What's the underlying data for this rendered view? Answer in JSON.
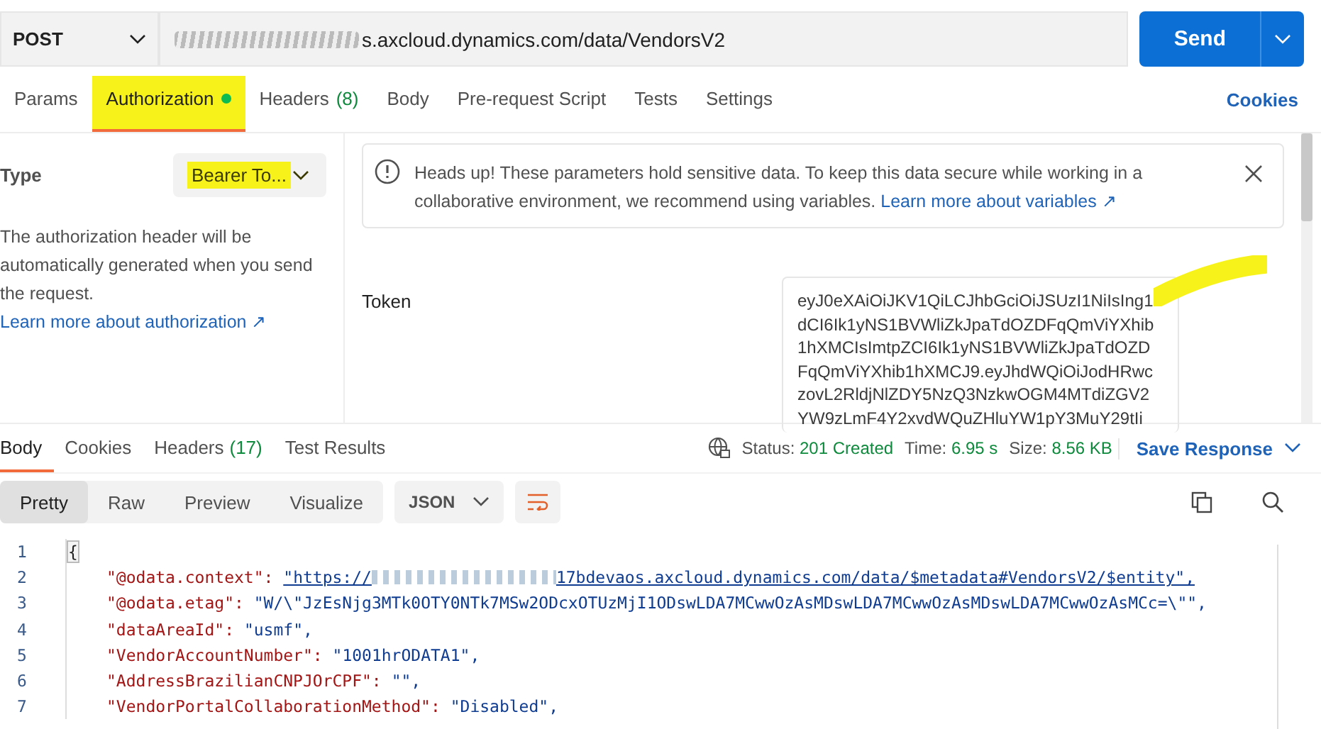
{
  "request": {
    "method": "POST",
    "url_visible": "s.axcloud.dynamics.com/data/VendorsV2",
    "send": "Send"
  },
  "request_tabs": [
    {
      "label": "Params",
      "selected": false,
      "dot": false
    },
    {
      "label": "Authorization",
      "selected": true,
      "dot": true
    },
    {
      "label": "Headers",
      "count": "(8)",
      "selected": false,
      "dot": false
    },
    {
      "label": "Body",
      "selected": false,
      "dot": false
    },
    {
      "label": "Pre-request Script",
      "selected": false,
      "dot": false
    },
    {
      "label": "Tests",
      "selected": false,
      "dot": false
    },
    {
      "label": "Settings",
      "selected": false,
      "dot": false
    }
  ],
  "cookies_link": "Cookies",
  "auth": {
    "type_label": "Type",
    "type_value": "Bearer To...",
    "description": "The authorization header will be automatically generated when you send the request.",
    "learn_more": "Learn more about authorization ↗"
  },
  "notice": {
    "text": "Heads up! These parameters hold sensitive data. To keep this data secure while working in a collaborative environment, we recommend using variables.",
    "link": "Learn more about variables ↗"
  },
  "token": {
    "label": "Token",
    "lines": [
      "eyJ0eXAiOiJKV1QiLCJhbGciOiJSUzI1NiIsIng1",
      "dCI6Ik1yNS1BVWliZkJpaTdOZDFqQmViYXhib",
      "1hXMCIsImtpZCI6Ik1yNS1BVWliZkJpaTdOZD",
      "FqQmViYXhib1hXMCJ9.eyJhdWQiOiJodHRwc",
      "zovL2RldjNlZDY5NzQ3NzkwOGM4MTdiZGV2",
      "YW9zLmF4Y2xvdWQuZHluYW1pY3MuY29tIi"
    ]
  },
  "response_tabs": [
    {
      "label": "Body",
      "selected": true
    },
    {
      "label": "Cookies",
      "selected": false
    },
    {
      "label": "Headers",
      "count": "(17)",
      "selected": false
    },
    {
      "label": "Test Results",
      "selected": false
    }
  ],
  "status": {
    "status_label": "Status:",
    "status_value": "201 Created",
    "time_label": "Time:",
    "time_value": "6.95 s",
    "size_label": "Size:",
    "size_value": "8.56 KB",
    "save": "Save Response"
  },
  "view_modes": [
    {
      "label": "Pretty",
      "selected": true
    },
    {
      "label": "Raw",
      "selected": false
    },
    {
      "label": "Preview",
      "selected": false
    },
    {
      "label": "Visualize",
      "selected": false
    }
  ],
  "format": "JSON",
  "code_lines": [
    {
      "number": "1",
      "kind": "brace",
      "text": "{"
    },
    {
      "number": "2",
      "kind": "link",
      "key": "\"@odata.context\":",
      "head": "\"https://",
      "tail": "17bdevaos.axcloud.dynamics.com/data/$metadata#VendorsV2/$entity\","
    },
    {
      "number": "3",
      "kind": "pair",
      "key": "\"@odata.etag\":",
      "value": "\"W/\\\"JzEsNjg3MTk0OTY0NTk7MSw2ODcxOTUzMjI1ODswLDA7MCwwOzAsMDswLDA7MCwwOzAsMDswLDA7MCwwOzAsMCc=\\\"\","
    },
    {
      "number": "4",
      "kind": "pair",
      "key": "\"dataAreaId\":",
      "value": "\"usmf\","
    },
    {
      "number": "5",
      "kind": "pair",
      "key": "\"VendorAccountNumber\":",
      "value": "\"1001hrODATA1\","
    },
    {
      "number": "6",
      "kind": "pair",
      "key": "\"AddressBrazilianCNPJOrCPF\":",
      "value": "\"\","
    },
    {
      "number": "7",
      "kind": "pair",
      "key": "\"VendorPortalCollaborationMethod\":",
      "value": "\"Disabled\","
    }
  ]
}
